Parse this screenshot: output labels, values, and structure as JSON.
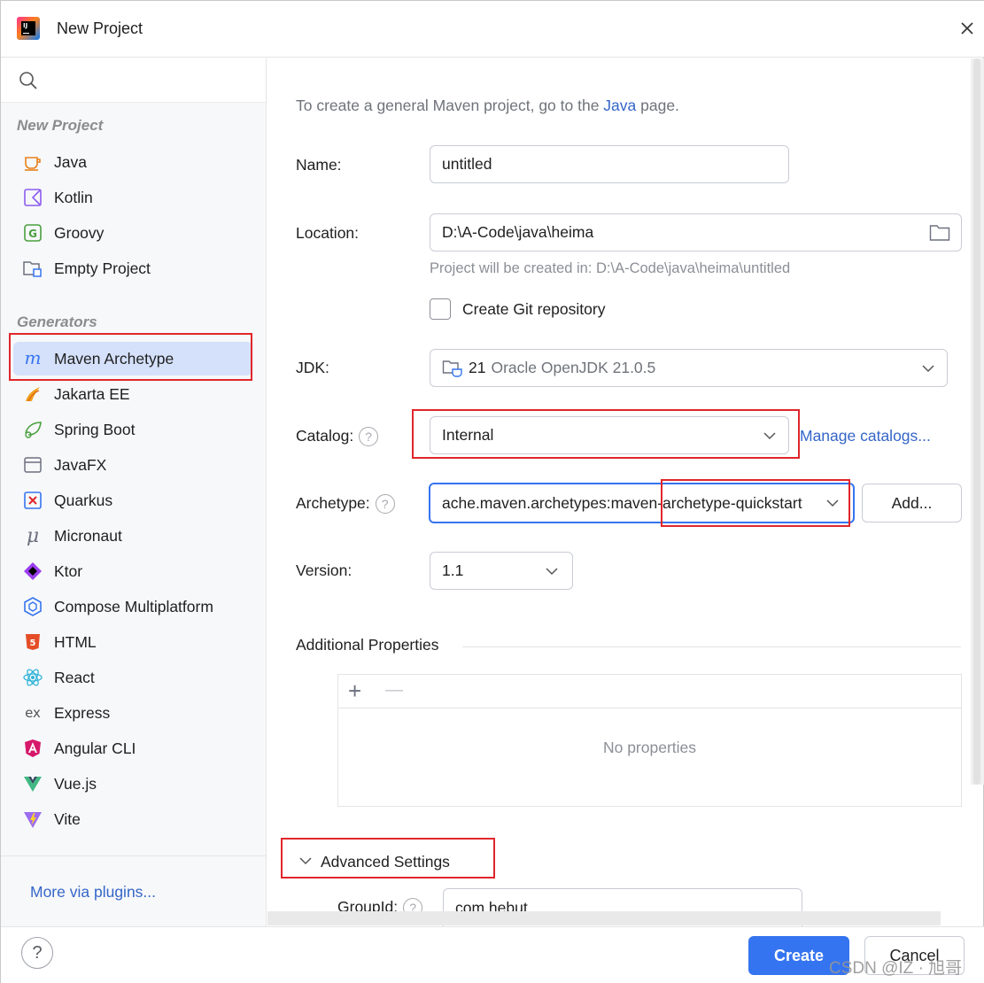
{
  "window": {
    "title": "New Project"
  },
  "search": {
    "placeholder": ""
  },
  "sidebar": {
    "group_new": "New Project",
    "new_items": [
      {
        "label": "Java",
        "icon": "java-cup-icon"
      },
      {
        "label": "Kotlin",
        "icon": "kotlin-icon"
      },
      {
        "label": "Groovy",
        "icon": "groovy-icon"
      },
      {
        "label": "Empty Project",
        "icon": "empty-project-icon"
      }
    ],
    "group_generators": "Generators",
    "generator_items": [
      {
        "label": "Maven Archetype",
        "icon": "maven-icon",
        "selected": true
      },
      {
        "label": "Jakarta EE",
        "icon": "jakarta-icon"
      },
      {
        "label": "Spring Boot",
        "icon": "spring-boot-icon"
      },
      {
        "label": "JavaFX",
        "icon": "javafx-icon"
      },
      {
        "label": "Quarkus",
        "icon": "quarkus-icon"
      },
      {
        "label": "Micronaut",
        "icon": "micronaut-icon"
      },
      {
        "label": "Ktor",
        "icon": "ktor-icon"
      },
      {
        "label": "Compose Multiplatform",
        "icon": "compose-icon"
      },
      {
        "label": "HTML",
        "icon": "html5-icon"
      },
      {
        "label": "React",
        "icon": "react-icon"
      },
      {
        "label": "Express",
        "icon": "express-icon"
      },
      {
        "label": "Angular CLI",
        "icon": "angular-icon"
      },
      {
        "label": "Vue.js",
        "icon": "vue-icon"
      },
      {
        "label": "Vite",
        "icon": "vite-icon"
      }
    ],
    "more_plugins": "More via plugins..."
  },
  "main": {
    "hint_prefix": "To create a general Maven project, go to the ",
    "hint_link": "Java",
    "hint_suffix": " page.",
    "name_label": "Name:",
    "name_value": "untitled",
    "location_label": "Location:",
    "location_value": "D:\\A-Code\\java\\heima",
    "location_note": "Project will be created in: D:\\A-Code\\java\\heima\\untitled",
    "git_checkbox_label": "Create Git repository",
    "git_checked": false,
    "jdk_label": "JDK:",
    "jdk_version": "21",
    "jdk_name": "Oracle OpenJDK 21.0.5",
    "catalog_label": "Catalog:",
    "catalog_value": "Internal",
    "manage_catalogs": "Manage catalogs...",
    "archetype_label": "Archetype:",
    "archetype_value": "ache.maven.archetypes:maven-archetype-quickstart",
    "add_button": "Add...",
    "version_label": "Version:",
    "version_value": "1.1",
    "additional_title": "Additional Properties",
    "add_prop": "+",
    "remove_prop": "—",
    "no_properties": "No properties",
    "advanced_title": "Advanced Settings",
    "groupid_label": "GroupId:",
    "groupid_value": "com.hebut"
  },
  "footer": {
    "help": "?",
    "create": "Create",
    "cancel": "Cancel"
  },
  "watermark": "CSDN @IZ · 旭哥",
  "colors": {
    "accent": "#3574f0",
    "link": "#3566c8",
    "selected": "#d5e1fb",
    "highlight": "#e0262b"
  }
}
